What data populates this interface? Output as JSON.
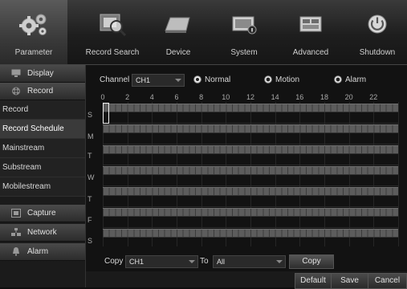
{
  "toolbar": {
    "items": [
      {
        "label": "Parameter",
        "icon": "gears-icon"
      },
      {
        "label": "Record Search",
        "icon": "magnifier-film-icon"
      },
      {
        "label": "Device",
        "icon": "hard-drive-icon"
      },
      {
        "label": "System",
        "icon": "monitor-info-icon"
      },
      {
        "label": "Advanced",
        "icon": "advanced-panel-icon"
      },
      {
        "label": "Shutdown",
        "icon": "power-icon"
      }
    ],
    "active_index": 0
  },
  "sidebar": {
    "display": "Display",
    "record": "Record",
    "record_item": "Record",
    "record_schedule": "Record Schedule",
    "mainstream": "Mainstream",
    "substream": "Substream",
    "mobilestream": "Mobilestream",
    "capture": "Capture",
    "network": "Network",
    "alarm": "Alarm"
  },
  "schedule": {
    "channel_label": "Channel",
    "channel_value": "CH1",
    "modes": [
      {
        "label": "Normal",
        "selected": true
      },
      {
        "label": "Motion",
        "selected": false
      },
      {
        "label": "Alarm",
        "selected": false
      }
    ],
    "hours": [
      "0",
      "2",
      "4",
      "6",
      "8",
      "10",
      "12",
      "14",
      "16",
      "18",
      "20",
      "22"
    ],
    "days": [
      "S",
      "M",
      "T",
      "W",
      "T",
      "F",
      "S"
    ]
  },
  "copy": {
    "copy_label": "Copy",
    "from_value": "CH1",
    "to_label": "To",
    "to_value": "All",
    "button": "Copy"
  },
  "actions": {
    "default": "Default",
    "save": "Save",
    "cancel": "Cancel"
  }
}
